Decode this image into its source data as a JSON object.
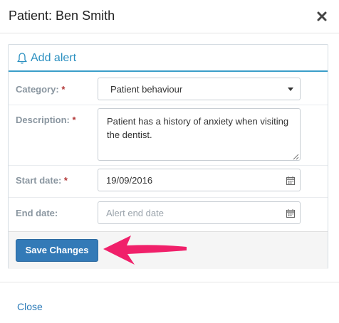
{
  "modal": {
    "title": "Patient: Ben Smith",
    "close_icon": "close-x-icon",
    "footer_close_label": "Close"
  },
  "panel": {
    "title": "Add alert",
    "icon": "bell-icon",
    "accent_color": "#3a9ec9"
  },
  "form": {
    "category": {
      "label": "Category:",
      "required_mark": "*",
      "value": "Patient behaviour"
    },
    "description": {
      "label": "Description:",
      "required_mark": "*",
      "value": "Patient has a history of anxiety when visiting the dentist."
    },
    "start_date": {
      "label": "Start date:",
      "required_mark": "*",
      "value": "19/09/2016"
    },
    "end_date": {
      "label": "End date:",
      "value": "",
      "placeholder": "Alert end date"
    }
  },
  "actions": {
    "save_label": "Save Changes",
    "save_color": "#337ab7"
  },
  "annotation": {
    "arrow_color": "#f0206a"
  }
}
